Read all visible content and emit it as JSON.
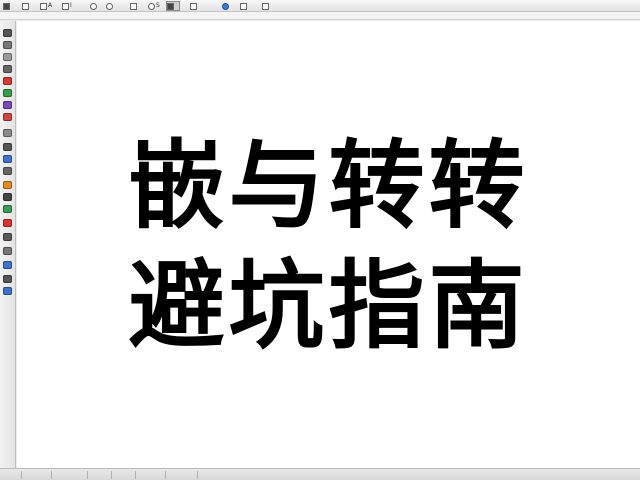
{
  "toolbar": {
    "buttons": [
      {
        "name": "file-icon",
        "label": ""
      },
      {
        "name": "save-icon",
        "label": ""
      },
      {
        "name": "print-icon",
        "label": "A"
      },
      {
        "name": "preview-icon",
        "label": "Ⅰ"
      },
      {
        "name": "undo-icon",
        "label": ""
      },
      {
        "name": "redo-icon",
        "label": ""
      },
      {
        "name": "copy-icon",
        "label": ""
      },
      {
        "name": "find-icon",
        "label": "S"
      },
      {
        "name": "select-icon",
        "label": ""
      },
      {
        "name": "image-icon",
        "label": ""
      },
      {
        "name": "help-icon",
        "label": ""
      }
    ]
  },
  "canvas": {
    "line1": "嵌与转转",
    "line2": "避坑指南"
  },
  "colors": {
    "text": "#000000",
    "canvas_bg": "#ffffff",
    "chrome": "#ececec"
  }
}
